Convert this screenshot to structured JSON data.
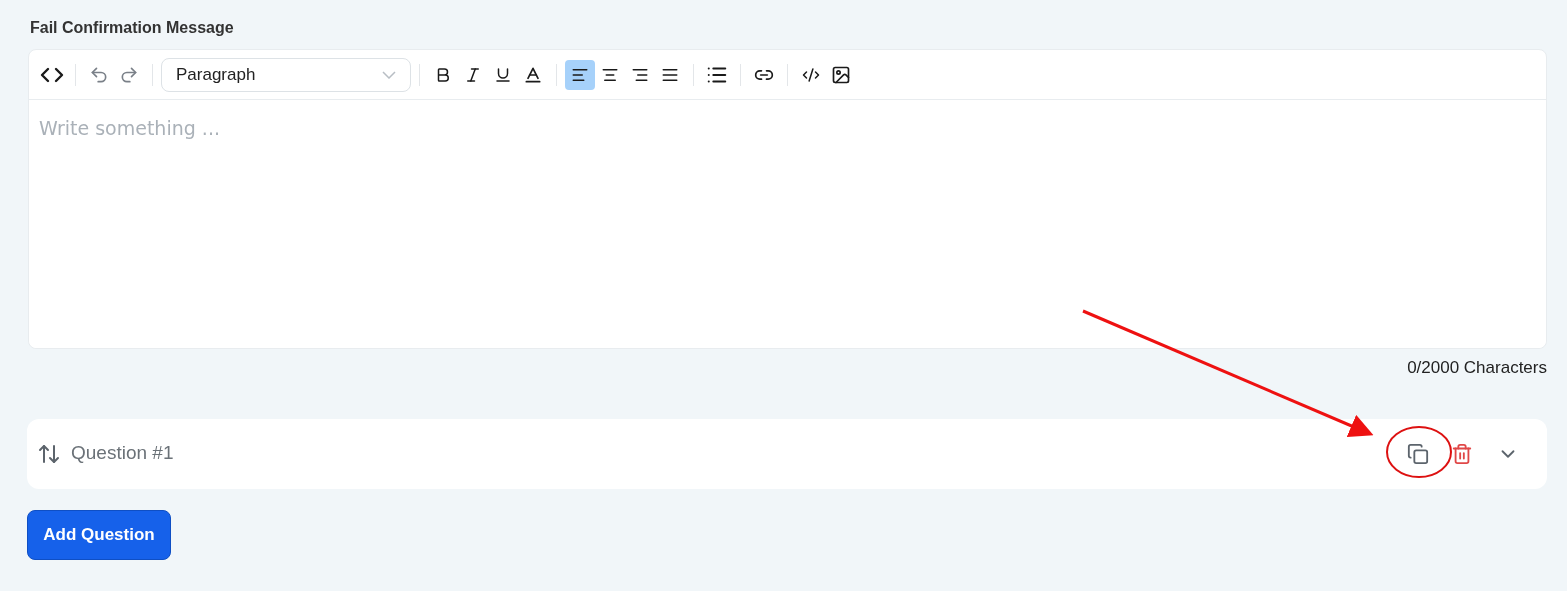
{
  "section_label": "Fail Confirmation Message",
  "toolbar": {
    "groups": [
      {
        "items": [
          {
            "kind": "source"
          }
        ]
      },
      {
        "items": [
          {
            "kind": "undo"
          },
          {
            "kind": "redo"
          }
        ]
      },
      {
        "items": [
          {
            "kind": "select",
            "value": "Paragraph"
          }
        ]
      },
      {
        "items": [
          {
            "kind": "bold"
          },
          {
            "kind": "italic"
          },
          {
            "kind": "underline"
          },
          {
            "kind": "text-color"
          }
        ]
      },
      {
        "items": [
          {
            "kind": "align-left",
            "selected": true
          },
          {
            "kind": "align-center",
            "selected": false
          },
          {
            "kind": "align-right",
            "selected": false
          },
          {
            "kind": "align-justify",
            "selected": false
          }
        ]
      },
      {
        "items": [
          {
            "kind": "bullet-list"
          }
        ]
      },
      {
        "items": [
          {
            "kind": "link"
          }
        ]
      },
      {
        "items": [
          {
            "kind": "code"
          },
          {
            "kind": "image"
          }
        ]
      }
    ]
  },
  "editor": {
    "placeholder": "Write something ..."
  },
  "char_count": "0/2000 Characters",
  "question": {
    "title": "Question #1"
  },
  "add_button": "Add Question"
}
